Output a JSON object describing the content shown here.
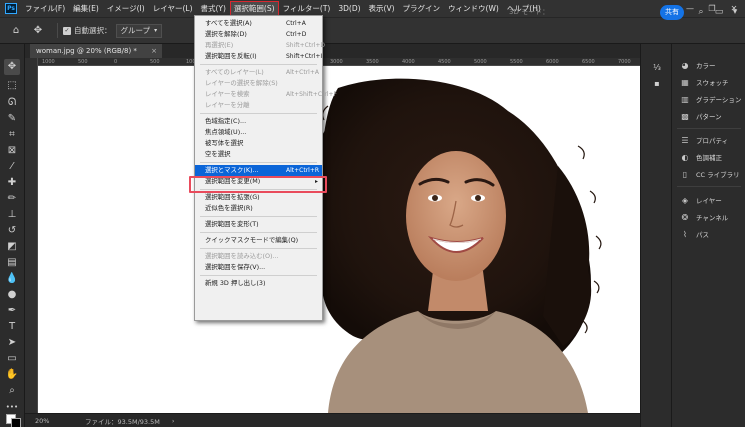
{
  "app": {
    "logo": "Ps"
  },
  "menubar": {
    "items": [
      {
        "label": "ファイル(F)"
      },
      {
        "label": "編集(E)"
      },
      {
        "label": "イメージ(I)"
      },
      {
        "label": "レイヤー(L)"
      },
      {
        "label": "書式(Y)"
      },
      {
        "label": "選択範囲(S)",
        "active": true
      },
      {
        "label": "フィルター(T)"
      },
      {
        "label": "3D(D)"
      },
      {
        "label": "表示(V)"
      },
      {
        "label": "プラグイン"
      },
      {
        "label": "ウィンドウ(W)"
      },
      {
        "label": "ヘルプ(H)"
      }
    ],
    "window_controls": [
      "—",
      "❐",
      "✕"
    ]
  },
  "optionsbar": {
    "auto_select_label": "自動選択：",
    "auto_select_value": "グループ",
    "mode_3d_label": "3D モード：",
    "share_label": "共有"
  },
  "document": {
    "tab_title": "woman.jpg @ 20% (RGB/8) *",
    "close_glyph": "×"
  },
  "ruler": {
    "ticks": [
      "1000",
      "500",
      "0",
      "500",
      "1000",
      "1500",
      "2000",
      "2500",
      "3000",
      "3500",
      "4000",
      "4500",
      "5000",
      "5500",
      "6000",
      "6500",
      "7000"
    ]
  },
  "status": {
    "zoom": "20%",
    "file_info": "ファイル：93.5M/93.5M",
    "arrow": "›"
  },
  "select_menu": {
    "items": [
      {
        "label": "すべてを選択(A)",
        "shortcut": "Ctrl+A",
        "state": "enabled"
      },
      {
        "label": "選択を解除(D)",
        "shortcut": "Ctrl+D",
        "state": "enabled"
      },
      {
        "label": "再選択(E)",
        "shortcut": "Shift+Ctrl+D",
        "state": "disabled"
      },
      {
        "label": "選択範囲を反転(I)",
        "shortcut": "Shift+Ctrl+I",
        "state": "enabled"
      },
      {
        "label": "すべてのレイヤー(L)",
        "shortcut": "Alt+Ctrl+A",
        "state": "disabled"
      },
      {
        "label": "レイヤーの選択を解除(S)",
        "shortcut": "",
        "state": "disabled"
      },
      {
        "label": "レイヤーを検索",
        "shortcut": "Alt+Shift+Ctrl+F",
        "state": "disabled"
      },
      {
        "label": "レイヤーを分離",
        "shortcut": "",
        "state": "disabled"
      },
      {
        "label": "色域指定(C)...",
        "shortcut": "",
        "state": "enabled"
      },
      {
        "label": "焦点領域(U)...",
        "shortcut": "",
        "state": "enabled"
      },
      {
        "label": "被写体を選択",
        "shortcut": "",
        "state": "enabled"
      },
      {
        "label": "空を選択",
        "shortcut": "",
        "state": "enabled"
      },
      {
        "label": "選択とマスク(K)...",
        "shortcut": "Alt+Ctrl+R",
        "state": "highlight"
      },
      {
        "label": "選択範囲を変更(M)",
        "shortcut": "",
        "state": "enabled",
        "submenu": "▸"
      },
      {
        "label": "選択範囲を拡張(G)",
        "shortcut": "",
        "state": "enabled"
      },
      {
        "label": "近似色を選択(R)",
        "shortcut": "",
        "state": "enabled"
      },
      {
        "label": "選択範囲を変形(T)",
        "shortcut": "",
        "state": "enabled"
      },
      {
        "label": "クイックマスクモードで編集(Q)",
        "shortcut": "",
        "state": "enabled"
      },
      {
        "label": "選択範囲を読み込む(O)...",
        "shortcut": "",
        "state": "disabled"
      },
      {
        "label": "選択範囲を保存(V)...",
        "shortcut": "",
        "state": "enabled"
      },
      {
        "label": "新規 3D 押し出し(3)",
        "shortcut": "",
        "state": "enabled"
      }
    ]
  },
  "right_panels": {
    "items": [
      {
        "label": "カラー",
        "icon": "palette-icon"
      },
      {
        "label": "スウォッチ",
        "icon": "swatches-icon"
      },
      {
        "label": "グラデーション",
        "icon": "gradient-icon"
      },
      {
        "label": "パターン",
        "icon": "pattern-icon"
      },
      {
        "label": "プロパティ",
        "icon": "properties-icon"
      },
      {
        "label": "色調補正",
        "icon": "adjustments-icon"
      },
      {
        "label": "CC ライブラリ",
        "icon": "libraries-icon"
      },
      {
        "label": "レイヤー",
        "icon": "layers-icon"
      },
      {
        "label": "チャンネル",
        "icon": "channels-icon"
      },
      {
        "label": "パス",
        "icon": "paths-icon"
      }
    ]
  },
  "colors": {
    "accent": "#1473e6",
    "menu_highlight": "#0b65d8",
    "callout_border": "#e94b5c"
  }
}
